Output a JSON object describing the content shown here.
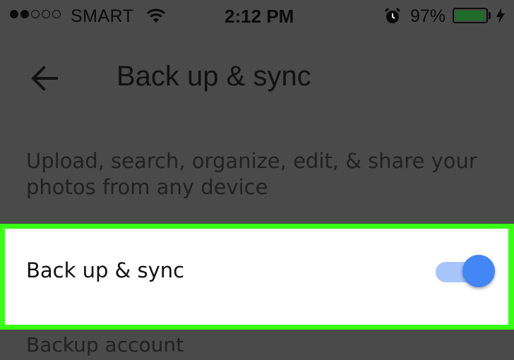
{
  "status_bar": {
    "carrier": "SMART",
    "time": "2:12 PM",
    "battery_percent": "97%",
    "signal_bars_filled": 2,
    "signal_bars_total": 5,
    "battery_level": 0.97,
    "icons": [
      "signal-dots-icon",
      "wifi-icon",
      "alarm-clock-icon",
      "battery-icon",
      "charging-bolt-icon"
    ]
  },
  "header": {
    "back_icon": "back-arrow-icon",
    "title": "Back up & sync"
  },
  "content": {
    "description": "Upload, search, organize, edit, & share your photos from any device",
    "backup_setting": {
      "label": "Back up & sync",
      "enabled": true
    },
    "section_header": "Backup account"
  },
  "colors": {
    "dim_overlay": "#4a4a4a",
    "highlight_border": "#39ff14",
    "toggle_on": "#4287f5",
    "toggle_track_on": "#a8c5fb",
    "battery_fill": "#1f6b2a"
  }
}
